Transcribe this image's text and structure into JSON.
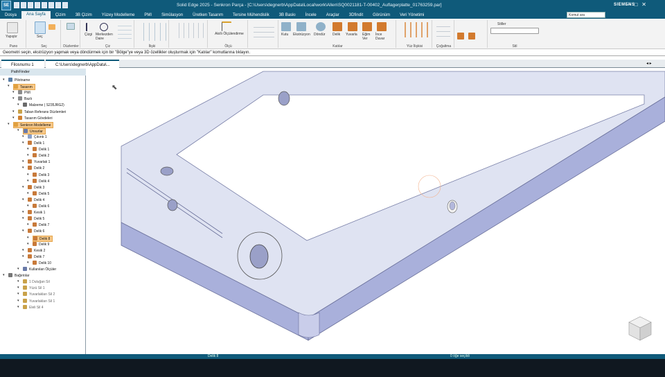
{
  "window": {
    "app_logo": "SE",
    "title": "Solid Edge 2025 - Senkron Parça - [C:\\Users\\degnerb\\AppData\\Local\\work\\Allen\\SQ0021181-T-00402_Auflagerplatte_01763259.par]",
    "brand": "SIEMENS",
    "controls": [
      "–",
      "□",
      "✕"
    ]
  },
  "menu": {
    "tabs": [
      "Dosya",
      "Ana Sayfa",
      "Çizim",
      "3B Çizim",
      "Yüzey Modelleme",
      "PMI",
      "Simülasyon",
      "Üretken Tasarım",
      "Tersine Mühendislik",
      "3B Baskı",
      "İncele",
      "Araçlar",
      "3Dfindit",
      "Görünüm",
      "Veri Yönetimi"
    ],
    "active_index": 1,
    "command_search": "Komut ara"
  },
  "ribbon": {
    "groups": [
      {
        "name": "Pano",
        "items": [
          "Yapıştır"
        ]
      },
      {
        "name": "Seç",
        "items": [
          "Seç",
          "Seç"
        ]
      },
      {
        "name": "Düzlemler",
        "items": []
      },
      {
        "name": "Çiz",
        "items": [
          "Çizgi",
          "Merkezden Daire"
        ]
      },
      {
        "name": "İlişki",
        "items": []
      },
      {
        "name": "Ölçü",
        "items": [
          "Akıllı Ölçülendirme"
        ]
      },
      {
        "name": "Katılar",
        "items": [
          "Kutu",
          "Ekstrüzyon",
          "Döndür",
          "Delik",
          "Yuvarla",
          "Eğim Ver",
          "İnce Duvar"
        ]
      },
      {
        "name": "Yüz İlişkisi",
        "items": []
      },
      {
        "name": "Çoğaltma",
        "items": []
      },
      {
        "name": "Stil",
        "items": [
          "Stiller"
        ]
      }
    ]
  },
  "prompt": "Geometri seçin, ekstrüzyon yapmak veya döndürmek için bir \"Bölge\"ye veya 3D özellikler oluşturmak için \"Katılar\" komutlarına tıklayın.",
  "doc_tabs": [
    {
      "label": "Filosnumu 1"
    },
    {
      "label": "C:\\Users\\degnerb\\AppData\\..."
    }
  ],
  "doc_nav": "◂ ▸",
  "pathfinder": {
    "title": "PathFinder",
    "rows": [
      {
        "label": "Pilotname",
        "indent": 0,
        "icon": "#5a7fa8",
        "hl": false
      },
      {
        "label": "Tasarım",
        "indent": 1,
        "icon": "#e0a040",
        "hl": true
      },
      {
        "label": "PMI",
        "indent": 2,
        "icon": "#8a8a8a",
        "hl": false
      },
      {
        "label": "Bazlı",
        "indent": 2,
        "icon": "#8a8a8a",
        "hl": false
      },
      {
        "label": "Malzeme ( S235JRG2)",
        "indent": 3,
        "icon": "#6a6a6a",
        "hl": false
      },
      {
        "label": "Taban Referans Düzlemleri",
        "indent": 2,
        "icon": "#c9a24a",
        "hl": false
      },
      {
        "label": "Tasarım Gövdeleri",
        "indent": 2,
        "icon": "#d08030",
        "hl": false
      },
      {
        "label": "Senkron Modelleme",
        "indent": 1,
        "icon": "#e0a040",
        "hl": true
      },
      {
        "label": "Unsurlar",
        "indent": 3,
        "icon": "#6a7aa8",
        "hl": true
      },
      {
        "label": "Çıkıntı 1",
        "indent": 4,
        "icon": "#8aa0c8",
        "hl": false
      },
      {
        "label": "Delik 1",
        "indent": 4,
        "icon": "#c87a3a",
        "hl": false
      },
      {
        "label": "Delik 1",
        "indent": 5,
        "icon": "#c87a3a",
        "hl": false
      },
      {
        "label": "Delik 2",
        "indent": 5,
        "icon": "#c87a3a",
        "hl": false
      },
      {
        "label": "Yuvarlak 1",
        "indent": 4,
        "icon": "#c87a3a",
        "hl": false
      },
      {
        "label": "Delik 2",
        "indent": 4,
        "icon": "#c87a3a",
        "hl": false
      },
      {
        "label": "Delik 3",
        "indent": 5,
        "icon": "#c87a3a",
        "hl": false
      },
      {
        "label": "Delik 4",
        "indent": 5,
        "icon": "#c87a3a",
        "hl": false
      },
      {
        "label": "Delik 3",
        "indent": 4,
        "icon": "#c87a3a",
        "hl": false
      },
      {
        "label": "Delik 5",
        "indent": 5,
        "icon": "#c87a3a",
        "hl": false
      },
      {
        "label": "Delik 4",
        "indent": 4,
        "icon": "#c87a3a",
        "hl": false
      },
      {
        "label": "Delik 6",
        "indent": 5,
        "icon": "#c87a3a",
        "hl": false
      },
      {
        "label": "Kesik 1",
        "indent": 4,
        "icon": "#c87a3a",
        "hl": false
      },
      {
        "label": "Delik 5",
        "indent": 4,
        "icon": "#c87a3a",
        "hl": false
      },
      {
        "label": "Delik 7",
        "indent": 5,
        "icon": "#c87a3a",
        "hl": false
      },
      {
        "label": "Delik 6",
        "indent": 4,
        "icon": "#c87a3a",
        "hl": false
      },
      {
        "label": "Delik 8",
        "indent": 5,
        "icon": "#c87a3a",
        "hl": true
      },
      {
        "label": "Delik 9",
        "indent": 5,
        "icon": "#c87a3a",
        "hl": false
      },
      {
        "label": "Kesik 2",
        "indent": 4,
        "icon": "#c87a3a",
        "hl": false
      },
      {
        "label": "Delik 7",
        "indent": 4,
        "icon": "#c87a3a",
        "hl": false
      },
      {
        "label": "Delik 10",
        "indent": 5,
        "icon": "#c87a3a",
        "hl": false
      },
      {
        "label": "Kullanılan Ölçüler",
        "indent": 3,
        "icon": "#6a7aa8",
        "hl": false
      },
      {
        "label": "Bağıntılar",
        "indent": 0,
        "icon": "#777",
        "hl": false
      },
      {
        "label": "1 Duluğan Sil",
        "indent": 3,
        "icon": "#c9a24a",
        "hl": false,
        "dim": true
      },
      {
        "label": "Yüzü Sil 1",
        "indent": 3,
        "icon": "#c9a24a",
        "hl": false,
        "dim": true
      },
      {
        "label": "Yuvarlakları Sil 2",
        "indent": 3,
        "icon": "#c9a24a",
        "hl": false,
        "dim": true
      },
      {
        "label": "Yuvarlakları Sil 1",
        "indent": 3,
        "icon": "#c9a24a",
        "hl": false,
        "dim": true
      },
      {
        "label": "Eleli Sil 4",
        "indent": 3,
        "icon": "#c9a24a",
        "hl": false,
        "dim": true
      }
    ]
  },
  "status": {
    "left": "Delik 8",
    "center": "0 öğe seçildi"
  },
  "colors": {
    "accent": "#0f5a7a",
    "part_top": "#dfe3f2",
    "part_side": "#a9b0db",
    "highlight": "#f7c98a"
  }
}
